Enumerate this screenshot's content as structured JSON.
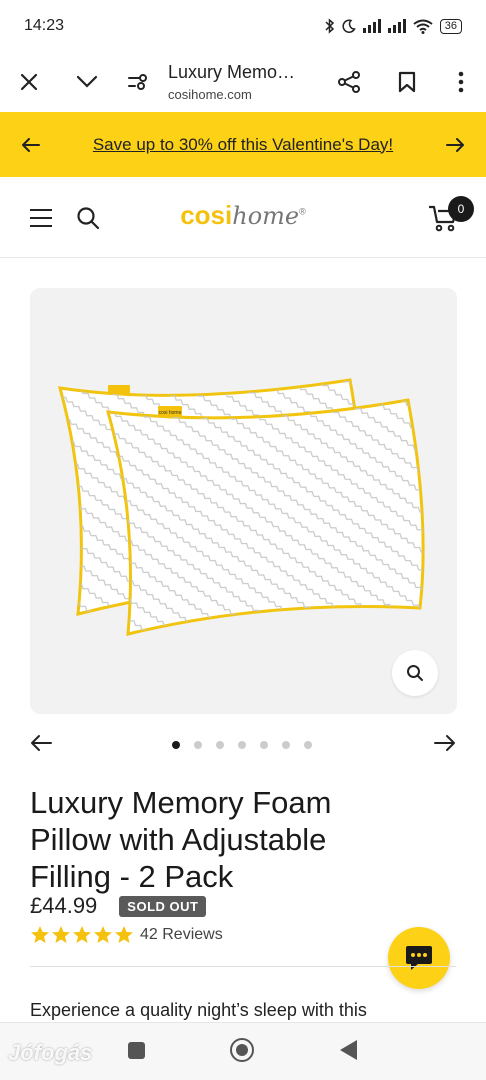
{
  "status_bar": {
    "time": "14:23",
    "battery": "36",
    "icons": [
      "bluetooth-icon",
      "moon-icon",
      "signal-icon",
      "signal-icon",
      "wifi-icon",
      "battery-icon"
    ]
  },
  "browser": {
    "page_title": "Luxury Memo…",
    "domain": "cosihome.com",
    "icons": [
      "close-icon",
      "chevron-down-icon",
      "page-settings-icon",
      "share-icon",
      "bookmark-icon",
      "more-vert-icon"
    ]
  },
  "promo": {
    "text": "Save up to 30% off this Valentine's Day!",
    "background": "#fcd116"
  },
  "header": {
    "logo_part1": "cosi",
    "logo_part2": "home",
    "logo_mark": "®",
    "cart_count": "0",
    "brand_color": "#f4c20d"
  },
  "product_image": {
    "label_small": "cosi home"
  },
  "carousel": {
    "total_slides": 7,
    "active_index": 0
  },
  "product": {
    "title": "Luxury Memory Foam Pillow with Adjustable Filling - 2 Pack",
    "price": "£44.99",
    "stock_badge": "SOLD OUT",
    "rating": 5,
    "reviews": "42 Reviews",
    "star_color": "#f4c20d"
  },
  "description": {
    "text": "Experience a quality night’s sleep with this"
  },
  "watermark": "Jófogás"
}
